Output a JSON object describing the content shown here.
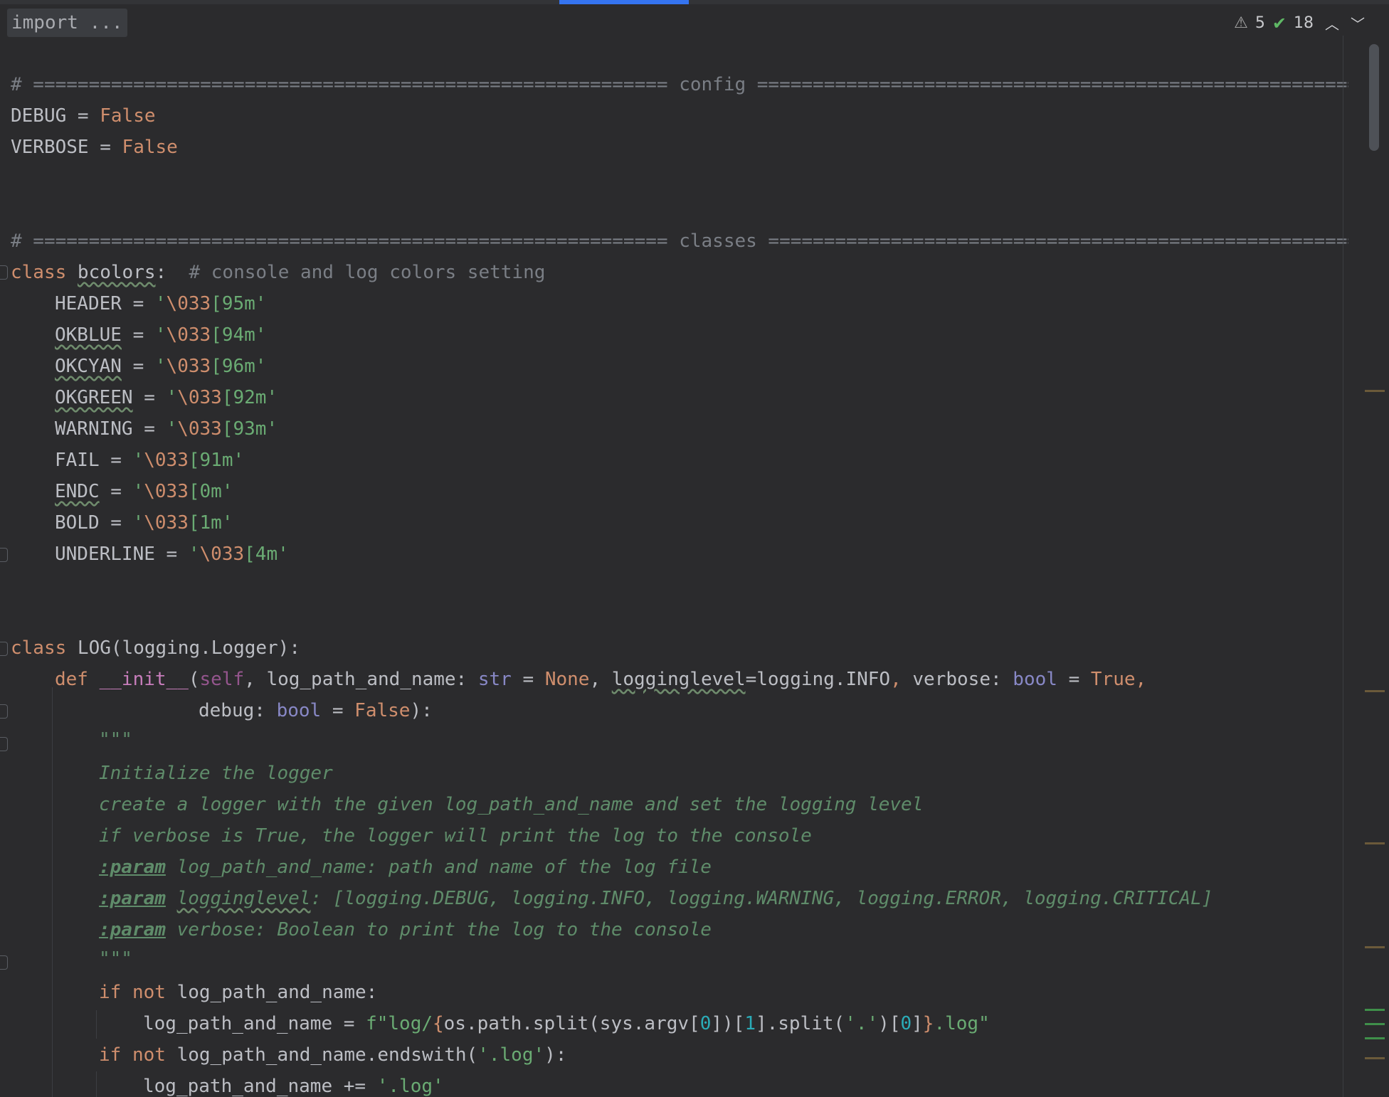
{
  "editor": {
    "import_fold": "import ...",
    "status": {
      "warnings": "5",
      "checks": "18"
    },
    "lines": {
      "l1": "# ========================================================= config =========================================================",
      "l2a": "DEBUG = ",
      "l2b": "False",
      "l3a": "VERBOSE = ",
      "l3b": "False",
      "l4": "# ========================================================= classes =========================================================",
      "l5a": "class ",
      "l5b": "bcolors",
      "l5c": ":  ",
      "l5d": "# console and log colors setting",
      "h1": "HEADER",
      "h1v1": "'",
      "h1v2": "\\033",
      "h1v3": "[95m'",
      "h2": "OKBLUE",
      "h2v1": "'",
      "h2v2": "\\033",
      "h2v3": "[94m'",
      "h3": "OKCYAN",
      "h3v1": "'",
      "h3v2": "\\033",
      "h3v3": "[96m'",
      "h4": "OKGREEN",
      "h4v1": "'",
      "h4v2": "\\033",
      "h4v3": "[92m'",
      "h5": "WARNING",
      "h5v1": "'",
      "h5v2": "\\033",
      "h5v3": "[93m'",
      "h6": "FAIL",
      "h6v1": "'",
      "h6v2": "\\033",
      "h6v3": "[91m'",
      "h7": "ENDC",
      "h7v1": "'",
      "h7v2": "\\033",
      "h7v3": "[0m'",
      "h8": "BOLD",
      "h8v1": "'",
      "h8v2": "\\033",
      "h8v3": "[1m'",
      "h9": "UNDERLINE",
      "h9v1": "'",
      "h9v2": "\\033",
      "h9v3": "[4m'",
      "c2a": "class ",
      "c2b": "LOG(logging.Logger):",
      "d1": "def ",
      "d2": "__init__",
      "d3": "(",
      "d4": "self",
      "d5": ", log_path_and_name: ",
      "d6": "str",
      "d7": " = ",
      "d8": "None",
      "d9": ", ",
      "d10": "logginglevel",
      "d11": "=logging.INFO",
      "d12": ", ",
      "d13": "verbose: ",
      "d14": "bool",
      "d15": " = ",
      "d16": "True",
      "d17": ",",
      "e1": "debug: ",
      "e2": "bool",
      "e3": " = ",
      "e4": "False",
      "e5": "):",
      "q1": "\"\"\"",
      "q2": "Initialize the logger",
      "q3": "create a logger with the given log_path_and_name and set the logging level",
      "q4": "if verbose is True, the logger will print the log to the console",
      "p1t": ":param",
      "p1": " log_path_and_name: path and name of the log file",
      "p2t": ":param",
      "p2a": " ",
      "p2b": "logginglevel",
      "p2c": ": [logging.DEBUG, logging.INFO, logging.WARNING, logging.ERROR, logging.CRITICAL]",
      "p3t": ":param",
      "p3": " verbose: Boolean to print the log to the console",
      "q5": "\"\"\"",
      "i1a": "if not",
      "i1b": " log_path_and_name:",
      "f1": "log_path_and_name = ",
      "f2": "f\"log/",
      "f3": "{",
      "f4": "os.path.split(sys.argv[",
      "f5": "0",
      "f6": "])[",
      "f7": "1",
      "f8": "].split(",
      "f9": "'.'",
      "f10": ")[",
      "f11": "0",
      "f12": "]",
      "f13": "}",
      "f14": ".log\"",
      "i2a": "if not",
      "i2b": " log_path_and_name.endswith(",
      "i2c": "'.log'",
      "i2d": "):",
      "g1": "log_path_and_name += ",
      "g2": "'.log'"
    }
  },
  "colors": {
    "background": "#2b2b2d",
    "keyword": "#cf8e6d",
    "string": "#6aab73",
    "comment": "#7a7e85",
    "docstring": "#5f8c6a",
    "number": "#2aacb8",
    "dunder": "#c77dbb",
    "builtin": "#8888c6",
    "accent": "#3574f0"
  },
  "icons": {
    "warning": "warning-triangle-icon",
    "check": "double-check-icon",
    "up": "chevron-up-icon",
    "down": "chevron-down-icon"
  }
}
